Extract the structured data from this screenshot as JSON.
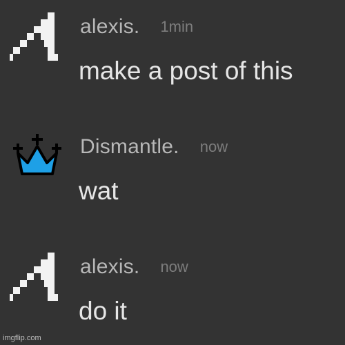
{
  "messages": [
    {
      "username": "alexis.",
      "timestamp": "1min",
      "text": "make a post of this",
      "avatar_icon": "pixel-a-logo-icon"
    },
    {
      "username": "Dismantle.",
      "timestamp": "now",
      "text": "wat",
      "avatar_icon": "crown-icon",
      "avatar_color": "#1ea0e6"
    },
    {
      "username": "alexis.",
      "timestamp": "now",
      "text": "do it",
      "avatar_icon": "pixel-a-logo-icon"
    }
  ],
  "watermark": "imgflip.com"
}
